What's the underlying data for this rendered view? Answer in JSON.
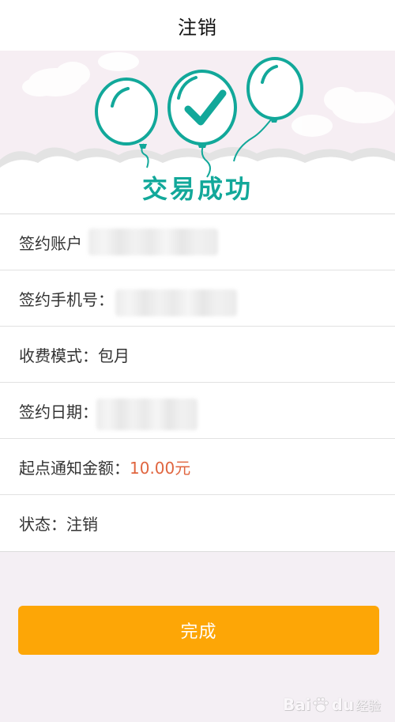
{
  "header": {
    "title": "注销"
  },
  "banner": {
    "success_text": "交易成功",
    "icons": [
      "balloon-icon",
      "balloon-check-icon",
      "balloon-icon"
    ],
    "accent_color": "#12a89a"
  },
  "info": {
    "rows": [
      {
        "label": "签约账户",
        "value": ""
      },
      {
        "label": "签约手机号：",
        "value": ""
      },
      {
        "label": "收费模式：",
        "value": "包月"
      },
      {
        "label": "签约日期：",
        "value": ""
      },
      {
        "label": "起点通知金额：",
        "value": "10.00元"
      },
      {
        "label": "状态：",
        "value": "注销"
      }
    ],
    "amount_color": "#e0653f"
  },
  "button": {
    "done_label": "完成",
    "color": "#fda606"
  },
  "watermark": {
    "brand": "Bai",
    "brand_suffix": "du",
    "sub": "经验"
  }
}
